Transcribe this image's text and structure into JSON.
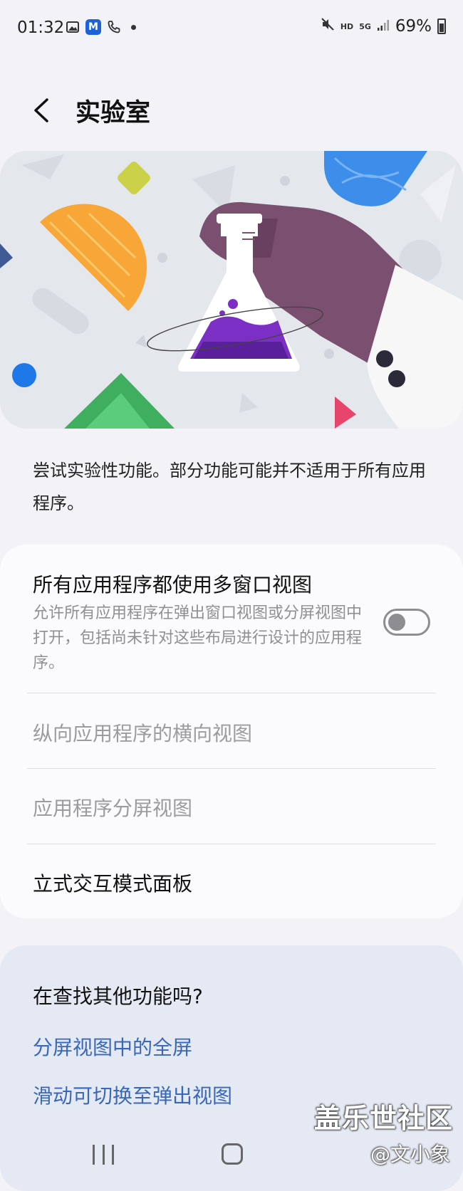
{
  "status_bar": {
    "time": "01:32",
    "network_hd": "HD",
    "network_5g": "5G",
    "battery": "69%"
  },
  "header": {
    "title": "实验室"
  },
  "description": "尝试实验性功能。部分功能可能并不适用于所有应用程序。",
  "settings": {
    "multi_window": {
      "title": "所有应用程序都使用多窗口视图",
      "subtitle": "允许所有应用程序在弹出窗口视图或分屏视图中打开，包括尚未针对这些布局进行设计的应用程序。",
      "toggle_on": false
    },
    "landscape_view": {
      "title": "纵向应用程序的横向视图"
    },
    "split_screen": {
      "title": "应用程序分屏视图"
    },
    "flex_panel": {
      "title": "立式交互模式面板"
    }
  },
  "suggestions": {
    "title": "在查找其他功能吗?",
    "links": [
      "分屏视图中的全屏",
      "滑动可切换至弹出视图"
    ]
  },
  "watermark": {
    "line1": "盖乐世社区",
    "line2": "@文小象"
  },
  "colors": {
    "background": "#f2f2f7",
    "card": "#fbfbfd",
    "suggestion_card": "#e4e9f4",
    "link": "#3a68b6",
    "flask_purple": "#7b2fc4",
    "hand_purple": "#7b4f70"
  }
}
